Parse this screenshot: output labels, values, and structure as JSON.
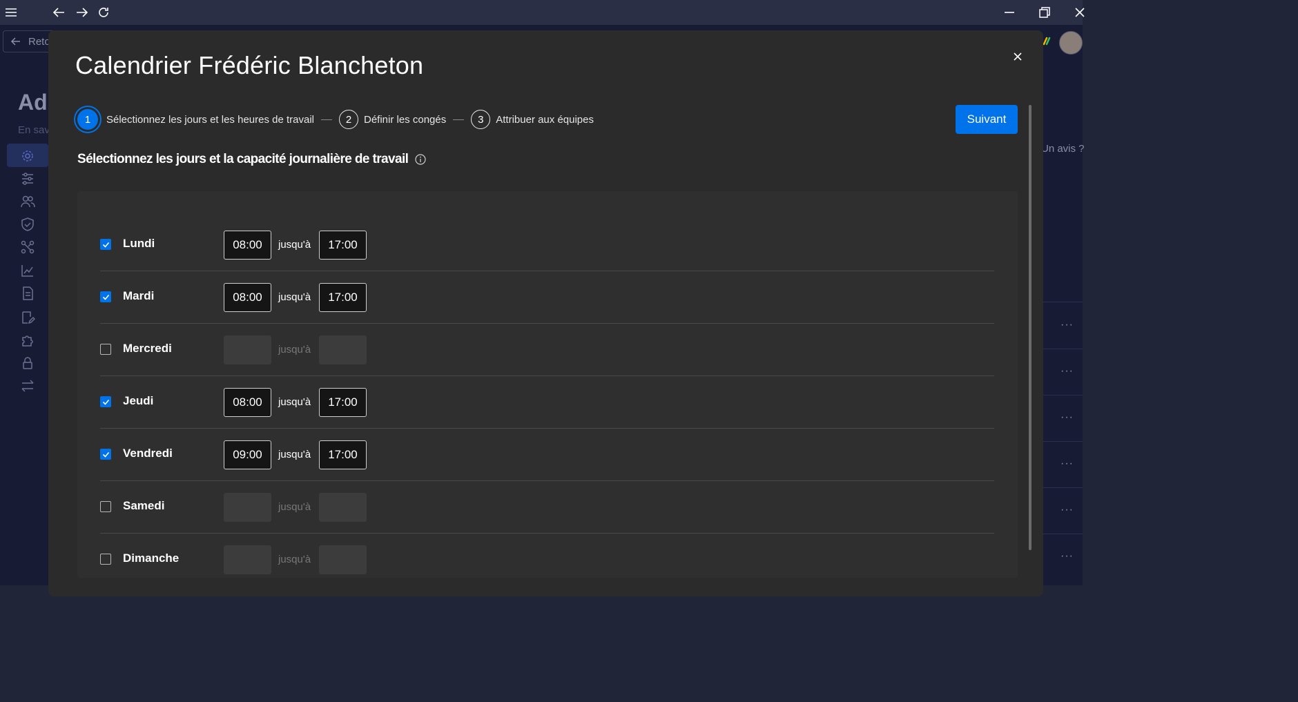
{
  "background": {
    "back_label": "Reto",
    "title_partial": "Ad",
    "subtitle_partial": "En sav",
    "right_text": "Un avis ?",
    "row_menu": "···"
  },
  "modal": {
    "title": "Calendrier Frédéric Blancheton",
    "steps": [
      {
        "num": "1",
        "label": "Sélectionnez les jours et les heures de travail"
      },
      {
        "num": "2",
        "label": "Définir les congés"
      },
      {
        "num": "3",
        "label": "Attribuer aux équipes"
      }
    ],
    "next_label": "Suivant",
    "section_title": "Sélectionnez les jours et la capacité journalière de travail",
    "until_label": "jusqu'à",
    "days": [
      {
        "name": "Lundi",
        "checked": true,
        "start": "08:00",
        "end": "17:00"
      },
      {
        "name": "Mardi",
        "checked": true,
        "start": "08:00",
        "end": "17:00"
      },
      {
        "name": "Mercredi",
        "checked": false,
        "start": "",
        "end": ""
      },
      {
        "name": "Jeudi",
        "checked": true,
        "start": "08:00",
        "end": "17:00"
      },
      {
        "name": "Vendredi",
        "checked": true,
        "start": "09:00",
        "end": "17:00"
      },
      {
        "name": "Samedi",
        "checked": false,
        "start": "",
        "end": ""
      },
      {
        "name": "Dimanche",
        "checked": false,
        "start": "",
        "end": ""
      }
    ]
  },
  "colors": {
    "accent": "#0073ea",
    "modal_bg": "#2b2b2b",
    "app_bg": "#181b34"
  }
}
